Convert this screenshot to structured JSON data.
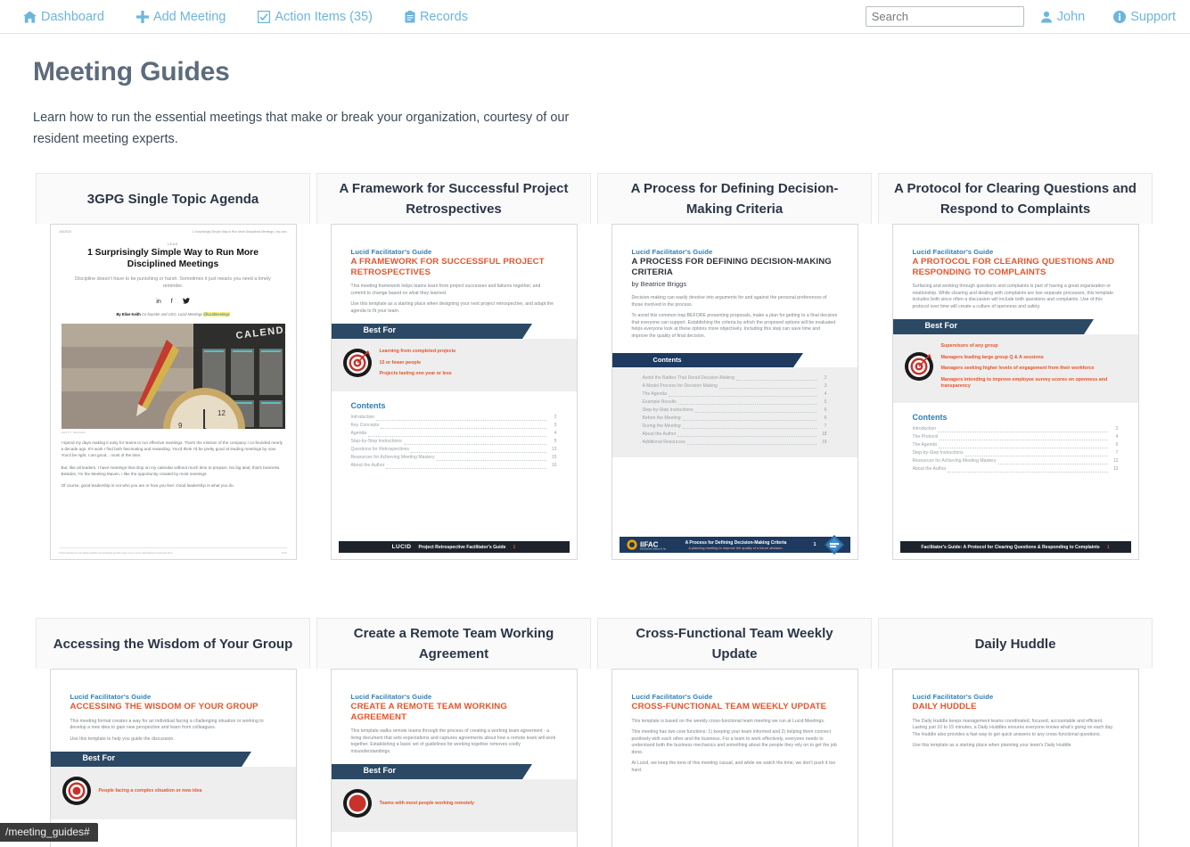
{
  "nav": {
    "left_items": [
      {
        "label": "Dashboard",
        "icon": "home-icon"
      },
      {
        "label": "Add Meeting",
        "icon": "plus-icon"
      },
      {
        "label": "Action Items (35)",
        "icon": "checkbox-icon"
      },
      {
        "label": "Records",
        "icon": "clipboard-icon"
      }
    ],
    "search": {
      "value": "",
      "placeholder": "Search"
    },
    "user": {
      "label": "John",
      "icon": "person-icon"
    },
    "support": {
      "label": "Support",
      "icon": "info-icon"
    },
    "accent_color": "#6cb6dd"
  },
  "page": {
    "title": "Meeting Guides",
    "description": "Learn how to run the essential meetings that make or break your organization, courtesy of our resident meeting experts."
  },
  "status_bar": {
    "text": "/meeting_guides#"
  },
  "guides": [
    {
      "title": "3GPG Single Topic Agenda",
      "thumb_type": "article",
      "article": {
        "date": "4/6/2020",
        "header": "1 Surprisingly Simple Way to Run More Disciplined Meetings | Inc.com",
        "lead": "LEAD",
        "headline": "1 Surprisingly Simple Way to Run More Disciplined Meetings",
        "subhead": "Discipline doesn't have to be punishing or harsh. Sometimes it just means you need a timely reminder.",
        "byline_author": "By Elise Keith",
        "byline_role": "Co-founder and CEO, Lucid Meetings",
        "byline_handle": "@lucidmeetings",
        "image_credit": "GETTY IMAGES",
        "paragraphs": [
          "I spend my days making it easy for teams to run effective meetings. That's the mission of the company I co-founded nearly a decade ago. It's work I find both fascinating and rewarding. You'd think I'd be pretty good at leading meetings by now. You'd be right. I am good... most of the time.",
          "But, like all leaders, I have meetings that drop on my calendar without much time to prepare. No big deal, that's business. Besides, I'm the Meeting Maven. I like the opportunity created by most meetings.",
          "Of course, good leadership is not who you are or how you feel. Good leadership is what you do."
        ],
        "footer_url": "https://www.inc.com/elise-keith/1-surprisingly-simple-way-to-run-more-disciplined-meetings.html",
        "footer_page": "1/10"
      }
    },
    {
      "title": "A Framework for Successful Project Retrospectives",
      "thumb_type": "guide",
      "guide": {
        "kicker": "Lucid Facilitator's Guide",
        "heading": "A FRAMEWORK FOR SUCCESSFUL PROJECT RETROSPECTIVES",
        "paragraphs": [
          "This meeting framework helps teams learn from project successes and failures together, and commit to change based on what they learned.",
          "Use this template as a starting place when designing your next project retrospective, and adapt the agenda to fit your team."
        ],
        "best_for_label": "Best For",
        "best_for": [
          "Learning from completed projects",
          "15 or fewer people",
          "Projects lasting one year or less"
        ],
        "contents_label": "Contents",
        "contents": [
          {
            "item": "Introduction",
            "page": "2"
          },
          {
            "item": "Key Concepts",
            "page": "3"
          },
          {
            "item": "Agenda",
            "page": "4"
          },
          {
            "item": "Step-by-Step Instructions",
            "page": "5"
          },
          {
            "item": "Questions for Retrospectives",
            "page": "13"
          },
          {
            "item": "Resources for Achieving Meeting Mastery",
            "page": "15"
          },
          {
            "item": "About the Author",
            "page": "16"
          }
        ],
        "footer_brand": "LUCID",
        "footer_text": "Project Retrospective Facilitator's Guide",
        "footer_page": "1"
      }
    },
    {
      "title": "A Process for Defining Decision-Making Criteria",
      "thumb_type": "guide-iifac",
      "guide": {
        "kicker": "Lucid Facilitator's Guide",
        "heading": "A PROCESS FOR DEFINING DECISION-MAKING CRITERIA",
        "byline": "by Beatrice Briggs",
        "paragraphs": [
          "Decision-making can easily devolve into arguments for and against the personal preferences of those involved in the process.",
          "To avoid this common trap BEFORE presenting proposals, make a plan for getting to a final decision that everyone can support. Establishing the criteria by which the proposed options will be evaluated helps everyone look at these options more objectively. Including this step can save time and improve the quality of final decision."
        ],
        "contents_label": "Contents",
        "contents": [
          {
            "item": "Avoid the Battles That Derail Decision-Making",
            "page": "2"
          },
          {
            "item": "A Model Process for Decision Making",
            "page": "3"
          },
          {
            "item": "The Agenda",
            "page": "4"
          },
          {
            "item": "Example Results",
            "page": "5"
          },
          {
            "item": "Step-by-Step Instructions",
            "page": "6"
          },
          {
            "item": "Before the Meeting",
            "page": "6"
          },
          {
            "item": "During the Meeting",
            "page": "7"
          },
          {
            "item": "About the Author",
            "page": "18"
          },
          {
            "item": "Additional Resources",
            "page": "19"
          }
        ],
        "footer_brand": "IIFAC",
        "footer_text": "A Process for Defining Decision-Making Criteria",
        "footer_subtext": "A planning meeting to improve the quality of a future decision.",
        "footer_page": "1"
      }
    },
    {
      "title": "A Protocol for Clearing Questions and Respond to Complaints",
      "thumb_type": "guide",
      "guide": {
        "kicker": "Lucid Facilitator's Guide",
        "heading": "A PROTOCOL FOR CLEARING QUESTIONS AND RESPONDING TO COMPLAINTS",
        "paragraphs": [
          "Surfacing and working through questions and complaints is part of having a great organization or relationship.  While clearing and dealing with complaints are two separate processes, this template includes both since often a discussion will include both questions and complaints. Use of this protocol over time will create a culture of openness and safety."
        ],
        "best_for_label": "Best For",
        "best_for": [
          "Supervisors of any group",
          "Managers leading large group Q & A sessions",
          "Managers seeking higher levels of engagement from their workforce",
          "Managers intending to improve employee survey scores on openness and transparency"
        ],
        "contents_label": "Contents",
        "contents": [
          {
            "item": "Introduction",
            "page": "2"
          },
          {
            "item": "The Protocol",
            "page": "4"
          },
          {
            "item": "The Agenda",
            "page": "6"
          },
          {
            "item": "Step-by-Step Instructions",
            "page": "7"
          },
          {
            "item": "Resources for Achieving Meeting Mastery",
            "page": "12"
          },
          {
            "item": "About the Author",
            "page": "13"
          }
        ],
        "footer_brand": "",
        "footer_text": "Facilitator's Guide: A Protocol for Clearing Questions & Responding to Complaints",
        "footer_page": "1"
      }
    },
    {
      "title": "Accessing the Wisdom of Your Group",
      "thumb_type": "guide",
      "guide": {
        "kicker": "Lucid Facilitator's Guide",
        "heading": "ACCESSING THE WISDOM OF YOUR GROUP",
        "paragraphs": [
          "This meeting format creates a way for an individual facing a challenging situation or working to develop a new idea to gain new perspective and learn from colleagues.",
          "Use this template to help you guide the discussion."
        ],
        "best_for_label": "Best For",
        "best_for": [
          "People facing a complex situation or new idea"
        ]
      }
    },
    {
      "title": "Create a Remote Team Working Agreement",
      "thumb_type": "guide",
      "guide": {
        "kicker": "Lucid Facilitator's Guide",
        "heading": "CREATE A REMOTE TEAM WORKING AGREEMENT",
        "paragraphs": [
          "This template walks remote teams through the process of creating a working team agreement - a living document that sets expectations and captures agreements about how a remote team will work together. Establishing a basic set of guidelines for working together removes costly misunderstandings."
        ],
        "best_for_label": "Best For",
        "best_for": [
          "Teams with most people working remotely"
        ]
      }
    },
    {
      "title": "Cross-Functional Team Weekly Update",
      "thumb_type": "guide",
      "guide": {
        "kicker": "Lucid Facilitator's Guide",
        "heading": "CROSS-FUNCTIONAL TEAM WEEKLY UPDATE",
        "paragraphs": [
          "This template is based on the weekly cross-functional team meeting we run at Lucid Meetings.",
          "This meeting has two core functions: 1) keeping your team informed and 2) helping them connect positively with each other and the business.  For a team to work effectively, everyone needs to understand both the business mechanics and something about the people they rely on to get the job done.",
          "At Lucid, we keep the tone of this meeting casual, and while we watch the time, we don't push it too hard."
        ]
      }
    },
    {
      "title": "Daily Huddle",
      "thumb_type": "guide",
      "guide": {
        "kicker": "Lucid Facilitator's Guide",
        "heading": "DAILY HUDDLE",
        "paragraphs": [
          "The Daily Huddle keeps management teams coordinated, focused, accountable and efficient. Lasting just 10 to 15 minutes, a Daily Huddles ensures everyone knows what's going on each day. The Huddle also provides a fast way to get quick answers to any cross-functional questions.",
          "Use this template as a starting place when planning your team's Daily Huddle."
        ]
      }
    }
  ]
}
